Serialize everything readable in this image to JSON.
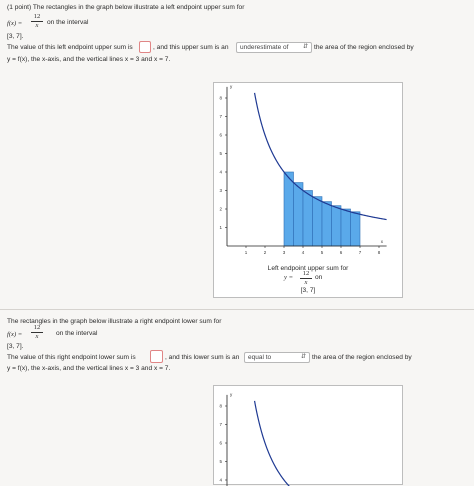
{
  "problem1": {
    "header": "(1 point) The rectangles in the graph below illustrate a left endpoint upper sum for",
    "fx_lhs": "f(x) =",
    "fx_num": "12",
    "fx_den": "x",
    "fx_suffix": "on the interval",
    "interval": "[3, 7].",
    "sentence_a": "The value of this left endpoint upper sum is",
    "sentence_b": ", and this upper sum is an",
    "select_value": "underestimate of",
    "sentence_c": "the area of the region enclosed by",
    "line2": "y = f(x), the x-axis, and the vertical lines x = 3 and x = 7.",
    "answer_value": "",
    "caption_title": "Left endpoint upper sum for",
    "caption_eq_lhs": "y =",
    "caption_num": "12",
    "caption_den": "x",
    "caption_on": "on",
    "caption_interval": "[3, 7]"
  },
  "problem2": {
    "header": "The rectangles in the graph below illustrate a right endpoint lower sum for",
    "fx_lhs": "f(x) =",
    "fx_num": "12",
    "fx_den": "x",
    "fx_suffix": "on the interval",
    "interval": "[3, 7].",
    "sentence_a": "The value of this right endpoint lower sum is",
    "sentence_b": ", and this lower sum is an",
    "select_value": "equal to",
    "sentence_c": "the area of the region enclosed by",
    "line2": "y = f(x), the x-axis, and the vertical lines x = 3 and x = 7.",
    "answer_value": ""
  },
  "colors": {
    "bar_fill": "#5aa9ea",
    "bar_stroke": "#2f6fb5",
    "curve": "#1f3a93",
    "answer_border": "#e08686"
  },
  "chart_data": [
    {
      "type": "bar",
      "title": "",
      "xlabel": "x",
      "ylabel": "y",
      "function": "12/x",
      "xlim": [
        0,
        8.4
      ],
      "ylim": [
        0,
        8.6
      ],
      "x_ticks": [
        "1",
        "2",
        "3",
        "4",
        "5",
        "6",
        "7",
        "8"
      ],
      "y_ticks": [
        "1",
        "2",
        "3",
        "4",
        "5",
        "6",
        "7",
        "8"
      ],
      "rect_width": 0.5,
      "x": [
        3,
        3.5,
        4,
        4.5,
        5,
        5.5,
        6,
        6.5
      ],
      "values": [
        4,
        3.43,
        3,
        2.67,
        2.4,
        2.18,
        2,
        1.85
      ]
    },
    {
      "type": "line",
      "title": "",
      "xlabel": "",
      "ylabel": "y",
      "function": "12/x",
      "y_ticks": [
        "4",
        "5",
        "6",
        "7",
        "8"
      ]
    }
  ]
}
